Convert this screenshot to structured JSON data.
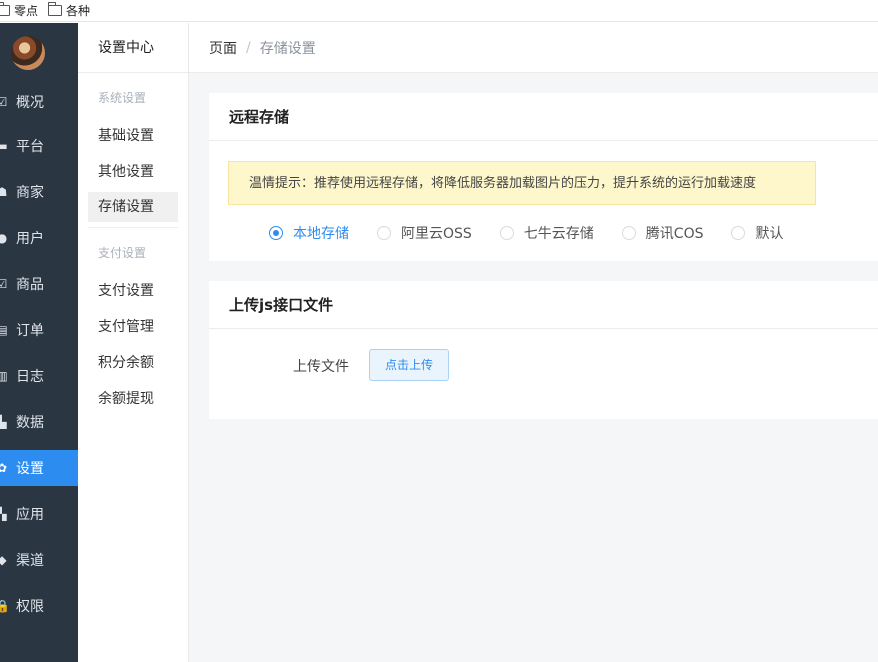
{
  "bookmarks": [
    {
      "label": "零点"
    },
    {
      "label": "各种"
    }
  ],
  "sidebar": {
    "items": [
      {
        "label": "概况",
        "icon": "overview-icon",
        "glyph": "☑",
        "active": false
      },
      {
        "label": "平台",
        "icon": "platform-icon",
        "glyph": "▬",
        "active": false
      },
      {
        "label": "商家",
        "icon": "merchant-icon",
        "glyph": "☗",
        "active": false
      },
      {
        "label": "用户",
        "icon": "user-icon",
        "glyph": "●",
        "active": false
      },
      {
        "label": "商品",
        "icon": "goods-icon",
        "glyph": "☑",
        "active": false
      },
      {
        "label": "订单",
        "icon": "order-icon",
        "glyph": "▤",
        "active": false
      },
      {
        "label": "日志",
        "icon": "log-icon",
        "glyph": "▥",
        "active": false
      },
      {
        "label": "数据",
        "icon": "chart-icon",
        "glyph": "▙",
        "active": false
      },
      {
        "label": "设置",
        "icon": "gear-icon",
        "glyph": "✿",
        "active": true
      },
      {
        "label": "应用",
        "icon": "apps-icon",
        "glyph": "▚",
        "active": false
      },
      {
        "label": "渠道",
        "icon": "channel-icon",
        "glyph": "◆",
        "active": false
      },
      {
        "label": "权限",
        "icon": "lock-icon",
        "glyph": "🔒",
        "active": false
      }
    ]
  },
  "subnav": {
    "title": "设置中心",
    "group1": "系统设置",
    "group1_items": [
      "基础设置",
      "其他设置",
      "存储设置"
    ],
    "group2": "支付设置",
    "group2_items": [
      "支付设置",
      "支付管理",
      "积分余额",
      "余额提现"
    ],
    "active": "存储设置"
  },
  "breadcrumb": {
    "home": "页面",
    "separator": "/",
    "current": "存储设置"
  },
  "remote_storage": {
    "title": "远程存储",
    "tip": "温情提示：推荐使用远程存储，将降低服务器加载图片的压力，提升系统的运行加载速度",
    "options": [
      "本地存储",
      "阿里云OSS",
      "七牛云存储",
      "腾讯COS",
      "默认"
    ],
    "selected": "本地存储"
  },
  "upload_js": {
    "title": "上传js接口文件",
    "field_label": "上传文件",
    "button_label": "点击上传"
  },
  "colors": {
    "accent": "#2d8cf0",
    "sidebar_bg": "#2b3643",
    "tip_bg": "#fef7cc"
  }
}
